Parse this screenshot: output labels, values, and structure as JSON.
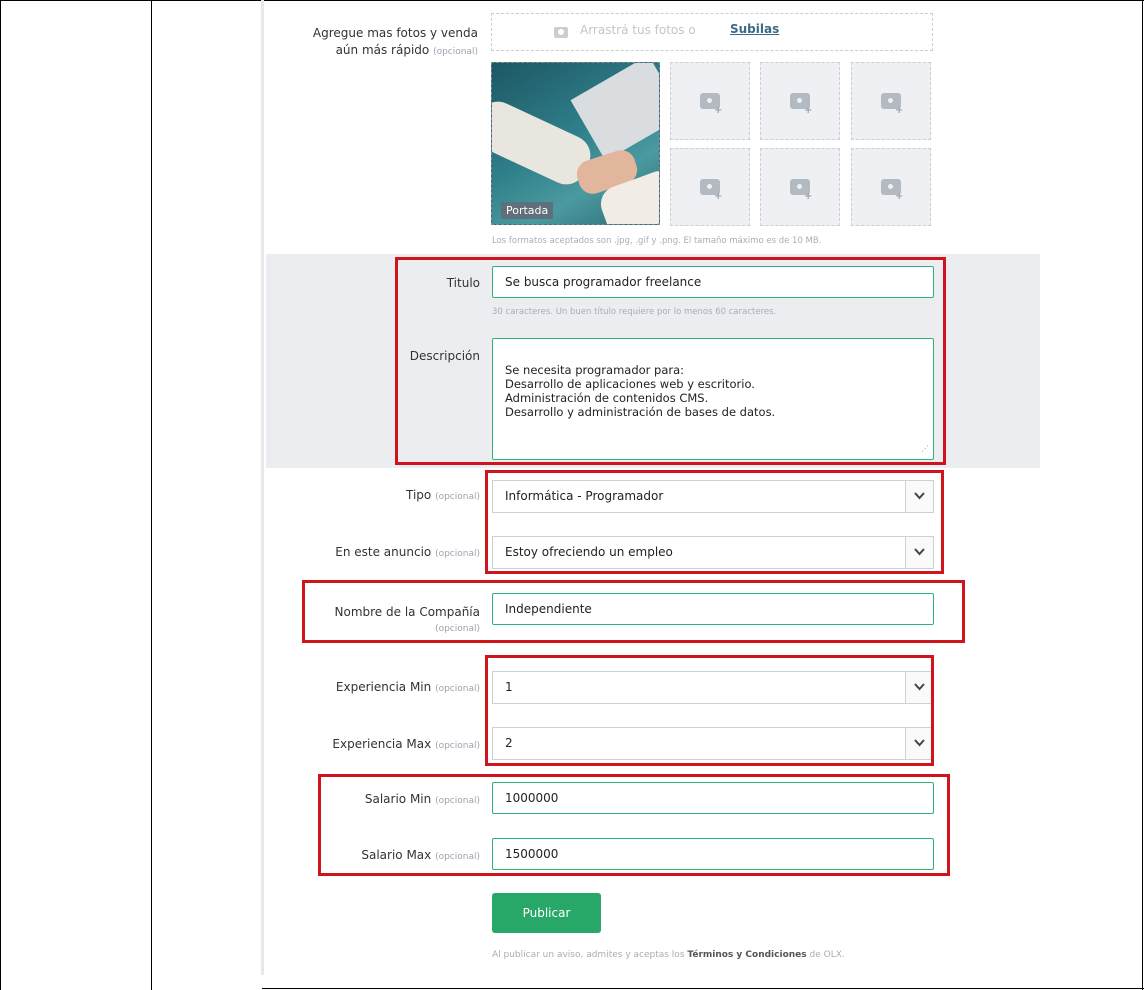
{
  "photos": {
    "label_line1": "Agregue mas fotos y venda",
    "label_line2": "aún más rápido",
    "optional": "(opcional)",
    "dropzone_text": "Arrastrá tus fotos o",
    "dropzone_link": "Subilas",
    "cover_badge": "Portada",
    "formats_hint": "Los formatos aceptados son .jpg, .gif y .png. El tamaño máximo es de 10 MB."
  },
  "titulo": {
    "label": "Titulo",
    "value": "Se busca programador freelance",
    "hint": "30 caracteres. Un buen título requiere por lo menos 60 caracteres."
  },
  "descripcion": {
    "label": "Descripción",
    "value": "Se necesita programador para:\nDesarrollo de aplicaciones web y escritorio.\nAdministración de contenidos CMS.\nDesarrollo y administración de bases de datos."
  },
  "tipo": {
    "label": "Tipo",
    "optional": "(opcional)",
    "selected": "Informática - Programador"
  },
  "anuncio": {
    "label": "En este anuncio",
    "optional": "(opcional)",
    "selected": "Estoy ofreciendo un empleo"
  },
  "compania": {
    "label": "Nombre de la Compañía",
    "optional": "(opcional)",
    "value": "Independiente"
  },
  "exp_min": {
    "label": "Experiencia Min",
    "optional": "(opcional)",
    "selected": "1"
  },
  "exp_max": {
    "label": "Experiencia Max",
    "optional": "(opcional)",
    "selected": "2"
  },
  "sal_min": {
    "label": "Salario Min",
    "optional": "(opcional)",
    "value": "1000000"
  },
  "sal_max": {
    "label": "Salario Max",
    "optional": "(opcional)",
    "value": "1500000"
  },
  "publish": {
    "button": "Publicar",
    "legal_prefix": "Al publicar un aviso, admites y aceptas los",
    "legal_link": "Términos y Condiciones",
    "legal_suffix": "de OLX."
  },
  "colors": {
    "accent_green": "#27a869",
    "input_border": "#2db37a",
    "highlight_red": "#d0141b"
  }
}
